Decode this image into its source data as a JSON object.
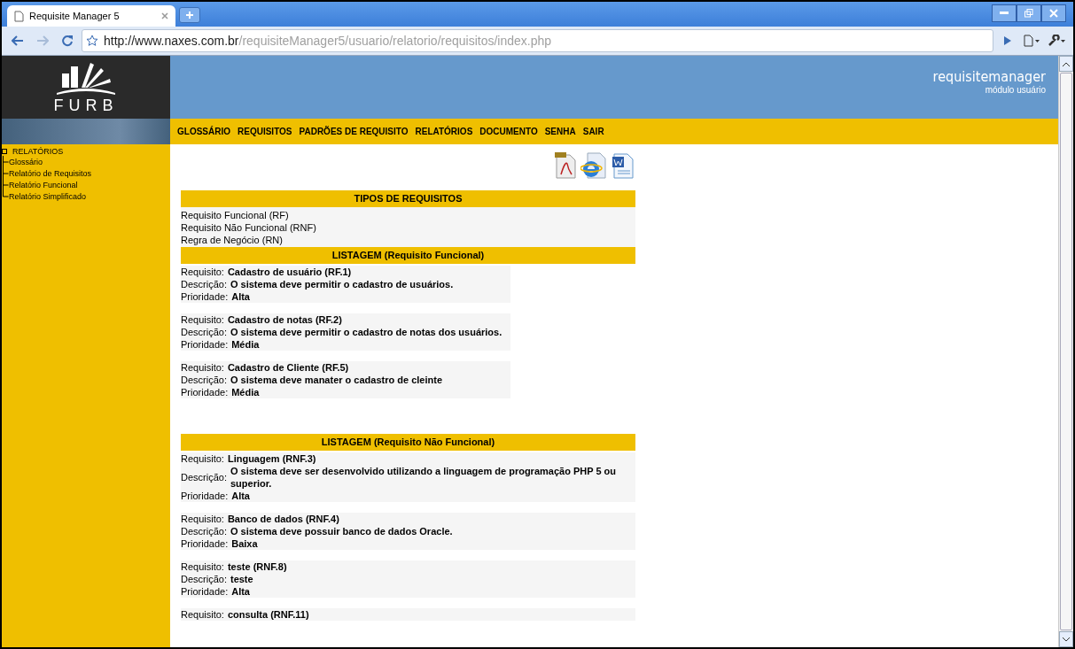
{
  "browser": {
    "tab_title": "Requisite Manager 5",
    "url_host": "http://www.naxes.com.br",
    "url_path": "/requisiteManager5/usuario/relatorio/requisitos/index.php"
  },
  "header": {
    "logo_text": "FURB",
    "app_name": "requisitemanager",
    "module": "módulo usuário"
  },
  "nav": [
    "GLOSSÁRIO",
    "REQUISITOS",
    "PADRÕES DE REQUISITO",
    "RELATÓRIOS",
    "DOCUMENTO",
    "SENHA",
    "SAIR"
  ],
  "sidebar": {
    "root": "RELATÓRIOS",
    "children": [
      {
        "label": "Glossário"
      },
      {
        "label": "Relatório de Requisitos"
      },
      {
        "label": "Relatório Funcional"
      },
      {
        "label": "Relatório Simplificado"
      }
    ]
  },
  "types": {
    "title": "TIPOS DE REQUISITOS",
    "items": [
      "Requisito Funcional (RF)",
      "Requisito Não Funcional (RNF)",
      "Regra de Negócio (RN)"
    ]
  },
  "sections": [
    {
      "title": "LISTAGEM (Requisito Funcional)",
      "narrow": true,
      "records": [
        {
          "fields": [
            {
              "label": "Requisito:",
              "value": "Cadastro de usuário (RF.1)"
            },
            {
              "label": "Descrição:",
              "value": "O sistema deve permitir o cadastro de usuários."
            },
            {
              "label": "Prioridade:",
              "value": "Alta"
            }
          ]
        },
        {
          "fields": [
            {
              "label": "Requisito:",
              "value": "Cadastro de notas (RF.2)"
            },
            {
              "label": "Descrição:",
              "value": "O sistema deve permitir o cadastro de notas dos usuários."
            },
            {
              "label": "Prioridade:",
              "value": "Média"
            }
          ]
        },
        {
          "fields": [
            {
              "label": "Requisito:",
              "value": "Cadastro de Cliente (RF.5)"
            },
            {
              "label": "Descrição:",
              "value": "O sistema deve manater o cadastro de cleinte"
            },
            {
              "label": "Prioridade:",
              "value": "Média"
            }
          ]
        }
      ]
    },
    {
      "title": "LISTAGEM (Requisito Não Funcional)",
      "narrow": false,
      "records": [
        {
          "fields": [
            {
              "label": "Requisito:",
              "value": "Linguagem (RNF.3)"
            },
            {
              "label": "Descrição:",
              "value": "O sistema deve ser desenvolvido utilizando a linguagem de programação PHP 5 ou superior."
            },
            {
              "label": "Prioridade:",
              "value": "Alta"
            }
          ]
        },
        {
          "fields": [
            {
              "label": "Requisito:",
              "value": "Banco de dados (RNF.4)"
            },
            {
              "label": "Descrição:",
              "value": "O sistema deve possuir banco de dados Oracle."
            },
            {
              "label": "Prioridade:",
              "value": "Baixa"
            }
          ]
        },
        {
          "fields": [
            {
              "label": "Requisito:",
              "value": "teste (RNF.8)"
            },
            {
              "label": "Descrição:",
              "value": "teste"
            },
            {
              "label": "Prioridade:",
              "value": "Alta"
            }
          ]
        },
        {
          "fields": [
            {
              "label": "Requisito:",
              "value": "consulta (RNF.11)"
            }
          ]
        }
      ]
    }
  ]
}
